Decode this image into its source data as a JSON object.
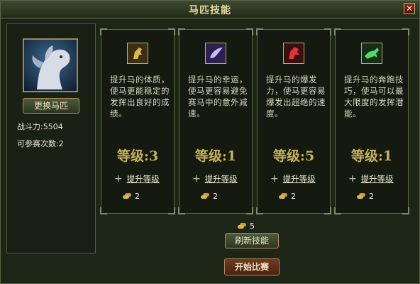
{
  "window": {
    "title": "马匹技能"
  },
  "left": {
    "change_horse_label": "更换马匹",
    "power_label": "战斗力:5504",
    "entries_label": "可参赛次数:2"
  },
  "cards": [
    {
      "icon": "horse-head-icon",
      "desc": "提升马的体质，使马更能稳定的发挥出良好的成绩。",
      "level": "等级:3",
      "upgrade": "提升等级",
      "cost": "2"
    },
    {
      "icon": "wing-icon",
      "desc": "提升马的幸运，使马更容易避免赛马中的意外减速。",
      "level": "等级:1",
      "upgrade": "提升等级",
      "cost": "2"
    },
    {
      "icon": "fire-horse-icon",
      "desc": "提升马的爆发力，使马更容易爆发出超绝的速度。",
      "level": "等级:5",
      "upgrade": "提升等级",
      "cost": "2"
    },
    {
      "icon": "running-horse-icon",
      "desc": "提升马的奔跑技巧，使马可以最大限度的发挥潜能。",
      "level": "等级:1",
      "upgrade": "提升等级",
      "cost": "2"
    }
  ],
  "footer": {
    "refresh_cost": "5",
    "refresh_label": "刷新技能",
    "start_label": "开始比赛"
  },
  "colors": {
    "gold": "#c7b15a",
    "panel": "#1d2516",
    "button_red": "#6f3b22",
    "button_green": "#4b5a3a"
  }
}
